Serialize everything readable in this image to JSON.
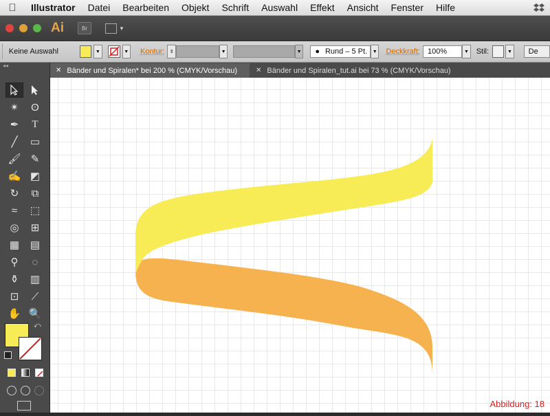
{
  "menubar": {
    "items": [
      "Illustrator",
      "Datei",
      "Bearbeiten",
      "Objekt",
      "Schrift",
      "Auswahl",
      "Effekt",
      "Ansicht",
      "Fenster",
      "Hilfe"
    ]
  },
  "appbar": {
    "logo": "Ai",
    "bridge_label": "Br"
  },
  "control": {
    "selection": "Keine Auswahl",
    "fill_color": "#f7ec55",
    "stroke_label": "Kontur:",
    "brush": "Rund – 5 Pt.",
    "opacity_label": "Deckkraft:",
    "opacity_value": "100%",
    "style_label": "Stil:",
    "right_button": "De"
  },
  "tabs": [
    {
      "label": "Bänder und Spiralen* bei 200 % (CMYK/Vorschau)",
      "active": true
    },
    {
      "label": "Bänder und Spiralen_tut.ai bei 73 % (CMYK/Vorschau)",
      "active": false
    }
  ],
  "colors": {
    "ribbon_front": "#f7ec55",
    "ribbon_back": "#f6b24e",
    "accent": "#e5a44b"
  },
  "caption": "Abbildung: 18"
}
